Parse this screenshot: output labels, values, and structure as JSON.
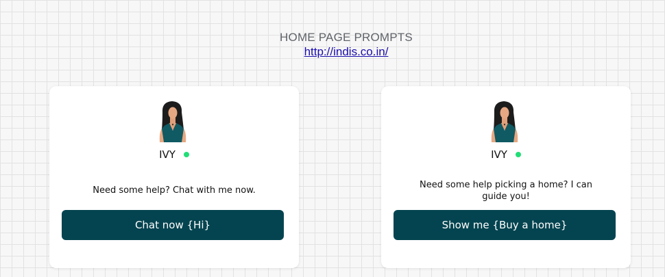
{
  "header": {
    "title": "HOME PAGE PROMPTS",
    "link": "http://indis.co.in/"
  },
  "cards": [
    {
      "agent_name": "IVY",
      "status_color": "#22dd77",
      "message": "Need some help? Chat with me now.",
      "button_label": "Chat now {Hi}",
      "button_color": "#044450",
      "avatar_icon": "woman-avatar-icon"
    },
    {
      "agent_name": "IVY",
      "status_color": "#22dd77",
      "message": "Need some help picking a home? I can guide you!",
      "button_label": "Show me {Buy a home}",
      "button_color": "#044450",
      "avatar_icon": "woman-avatar-icon"
    }
  ]
}
